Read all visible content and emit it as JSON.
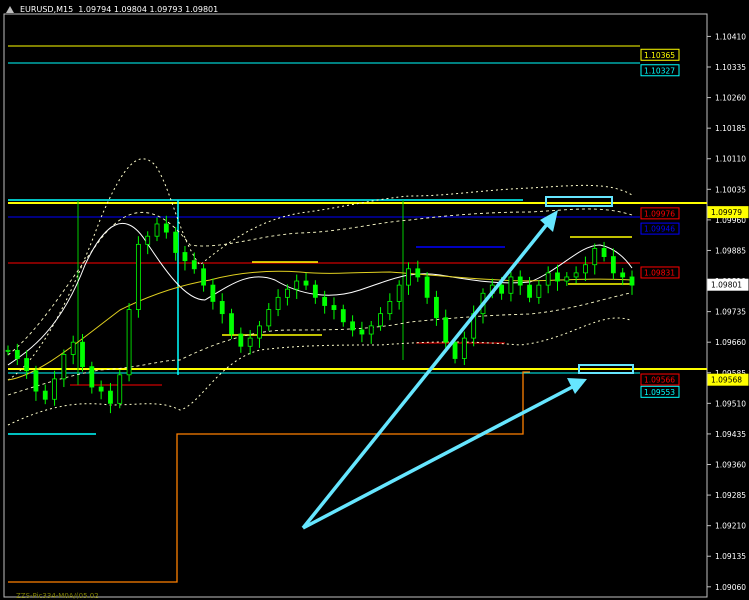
{
  "header": {
    "symbol": "EURUSD,M15",
    "ohlc": "1.09794 1.09804 1.09793 1.09801"
  },
  "footer": {
    "text": "ZZS-Pic334-M0A/(05.02"
  },
  "colors": {
    "background": "#000000",
    "candle": "#00ff00",
    "grid": "#808080",
    "yellow_level": "#ffff00",
    "cyan_level": "#00ffff",
    "blue_level": "#0000ff",
    "red_level": "#ff0000",
    "orange_line": "#ff8000",
    "arrow": "#66e6ff"
  },
  "chart_data": {
    "type": "candlestick",
    "title": "EURUSD,M15",
    "yaxis": {
      "range": [
        1.09035,
        1.10465
      ],
      "ticks": [
        "1.10410",
        "1.10335",
        "1.10260",
        "1.10185",
        "1.10110",
        "1.10035",
        "1.09960",
        "1.09885",
        "1.09810",
        "1.09735",
        "1.09660",
        "1.09585",
        "1.09510",
        "1.09435",
        "1.09360",
        "1.09285",
        "1.09210",
        "1.09135",
        "1.09060"
      ]
    },
    "price_labels": [
      {
        "value": 1.10365,
        "text": "1.10365",
        "color": "#ffff00"
      },
      {
        "value": 1.10327,
        "text": "1.10327",
        "color": "#00ffff"
      },
      {
        "value": 1.09979,
        "text": "1.09979",
        "color": "#ffff00"
      },
      {
        "value": 1.09976,
        "text": "1.09976",
        "color": "#ff0000"
      },
      {
        "value": 1.09946,
        "text": "1.09946",
        "color": "#0000ff"
      },
      {
        "value": 1.09831,
        "text": "1.09831",
        "color": "#ff0000"
      },
      {
        "value": 1.09801,
        "text": "1.09801",
        "color": "#ffffff"
      },
      {
        "value": 1.09568,
        "text": "1.09568",
        "color": "#ffff00"
      },
      {
        "value": 1.09566,
        "text": "1.09566",
        "color": "#ff0000"
      },
      {
        "value": 1.09553,
        "text": "1.09553",
        "color": "#00ffff"
      }
    ],
    "close": [
      1.0964,
      1.0962,
      1.0959,
      1.0954,
      1.0952,
      1.0957,
      1.0963,
      1.0966,
      1.096,
      1.0955,
      1.0954,
      1.0951,
      1.0958,
      1.0974,
      1.099,
      1.0992,
      1.0995,
      1.0993,
      1.0988,
      1.0986,
      1.0984,
      1.098,
      1.0976,
      1.0973,
      1.0968,
      1.0965,
      1.0967,
      1.097,
      1.0974,
      1.0977,
      1.0979,
      1.0981,
      1.098,
      1.0977,
      1.0975,
      1.0974,
      1.0971,
      1.0969,
      1.0968,
      1.097,
      1.0973,
      1.0976,
      1.098,
      1.0984,
      1.0982,
      1.0977,
      1.0972,
      1.0966,
      1.0962,
      1.0967,
      1.0973,
      1.0978,
      1.098,
      1.0978,
      1.0982,
      1.098,
      1.0977,
      1.098,
      1.0983,
      1.0981,
      1.0982,
      1.0983,
      1.0985,
      1.0989,
      1.0987,
      1.0983,
      1.0982,
      1.098
    ]
  }
}
